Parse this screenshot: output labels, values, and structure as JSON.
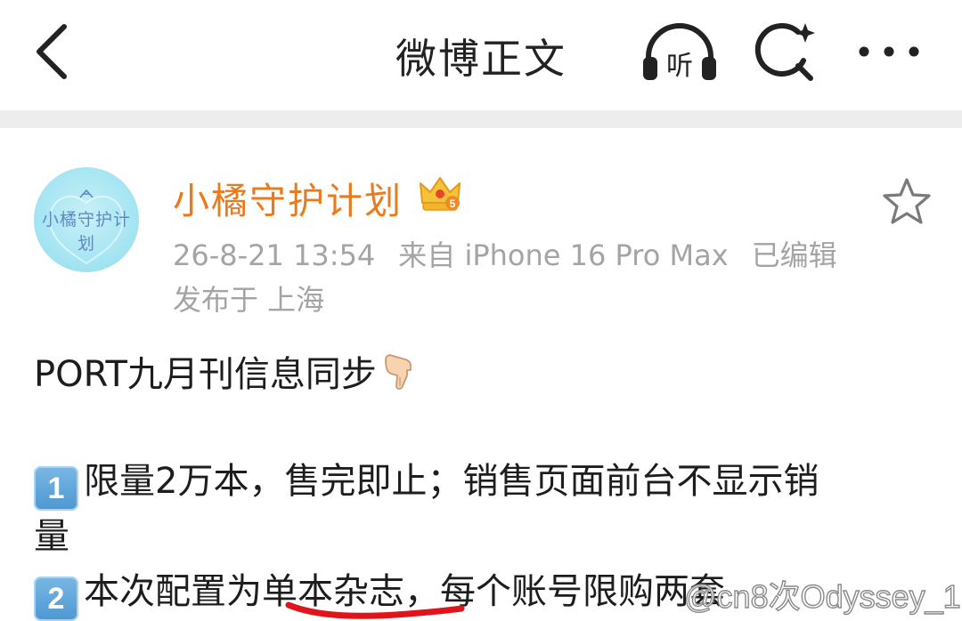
{
  "header": {
    "title": "微博正文",
    "listen_label": "听",
    "icons": {
      "back": "chevron-left-icon",
      "listen": "headphones-icon",
      "search": "sparkle-search-icon",
      "more": "more-dots-icon"
    }
  },
  "post": {
    "author": {
      "name": "小橘守护计划",
      "avatar_text": "小橘守护计划",
      "badge_icon": "crown-badge-icon",
      "badge_level": "5"
    },
    "timestamp": "26-8-21 13:54",
    "source": "来自 iPhone 16 Pro Max",
    "edited": "已编辑",
    "location": "发布于 上海",
    "favorite_icon": "star-outline-icon",
    "content": {
      "intro": "PORT九月刊信息同步",
      "intro_emoji": "pointing-down-hand-icon",
      "item1_number": "1",
      "item1_text": "限量2万本，售完即止；销售页面前台不显示销",
      "item1_text_cont": "量",
      "item2_number": "2",
      "item2_text_a": "本次配置为",
      "item2_text_highlight": "单本杂志",
      "item2_text_b": "，每个账号限购两套"
    }
  },
  "watermark": "@cn8次Odyssey_1",
  "colors": {
    "username": "#ea7a1b",
    "meta_gray": "#a4a4a4",
    "separator": "#ededed",
    "underline_red": "#e0151b",
    "keycap_blue": "#4d97d2"
  }
}
